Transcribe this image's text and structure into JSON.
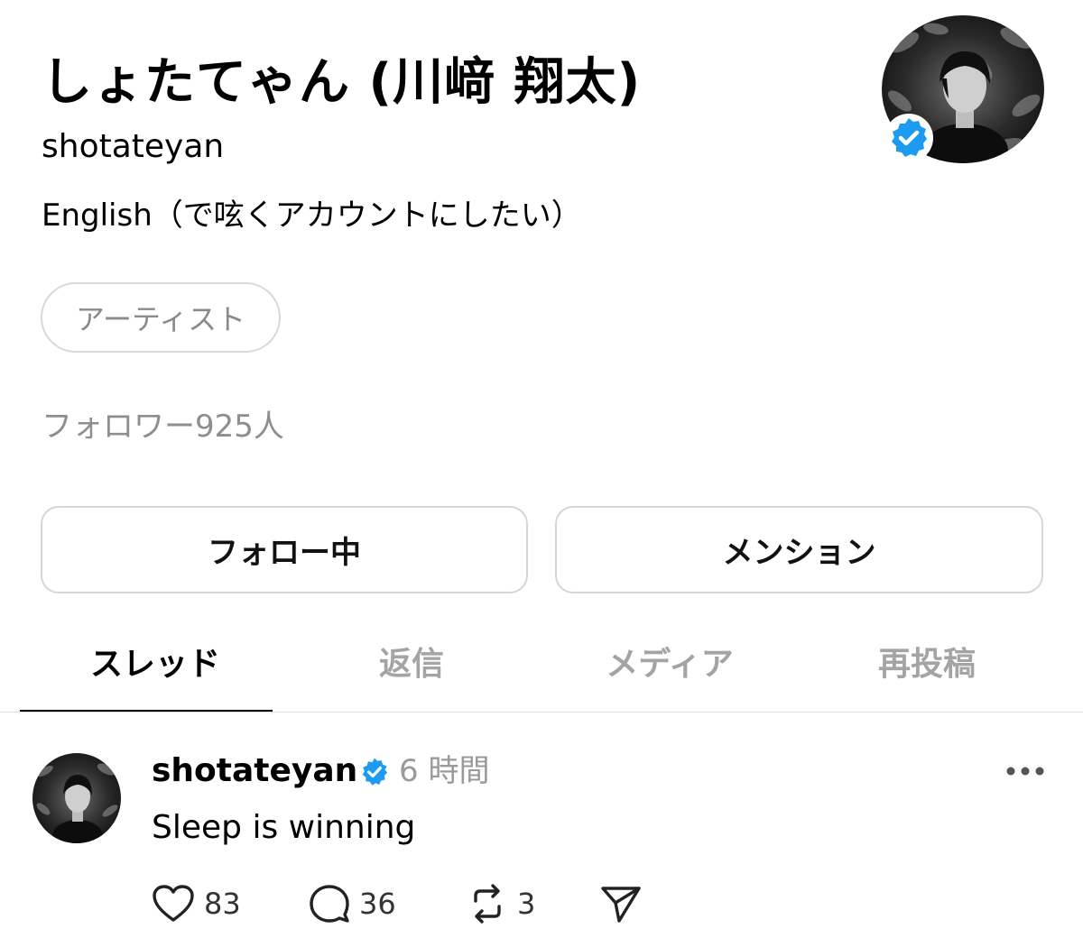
{
  "profile": {
    "display_name": "しょたてゃん (川﨑 翔太)",
    "handle": "shotateyan",
    "bio": "English（で呟くアカウントにしたい）",
    "tag": "アーティスト",
    "followers_label": "フォロワー925人",
    "verified": true
  },
  "buttons": {
    "follow": "フォロー中",
    "mention": "メンション"
  },
  "tabs": [
    {
      "label": "スレッド",
      "active": true
    },
    {
      "label": "返信",
      "active": false
    },
    {
      "label": "メディア",
      "active": false
    },
    {
      "label": "再投稿",
      "active": false
    }
  ],
  "post": {
    "username": "shotateyan",
    "time": "6 時間",
    "text": "Sleep is winning",
    "likes": "83",
    "replies": "36",
    "reposts": "3"
  },
  "colors": {
    "verified_blue": "#1d9bf0",
    "muted_text": "#8e8e8e",
    "border": "#d6d6d6"
  },
  "icons": {
    "like": "heart-icon",
    "reply": "comment-icon",
    "repost": "repost-icon",
    "share": "send-icon",
    "more": "more-horizontal-icon",
    "verified": "verified-badge-icon"
  }
}
